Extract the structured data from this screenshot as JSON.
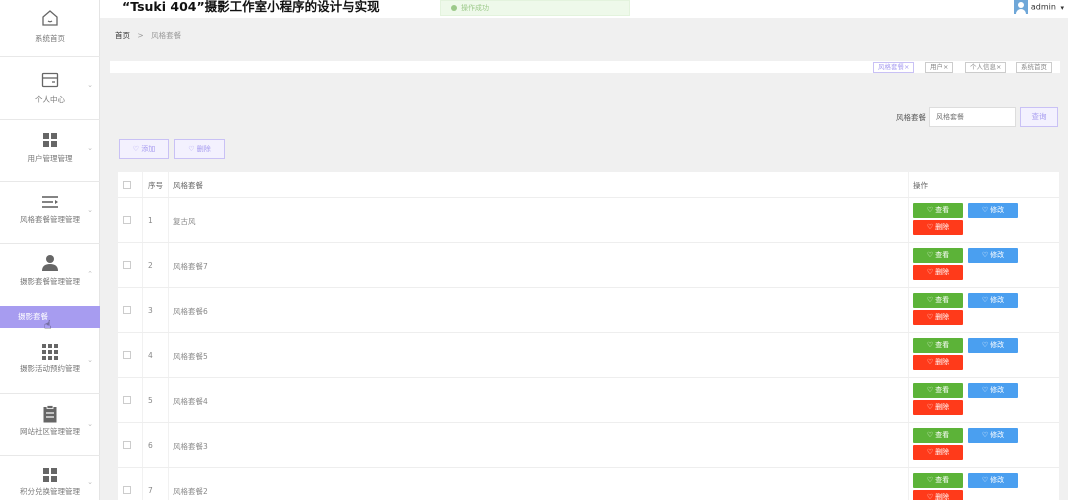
{
  "header": {
    "title": "“Tsuki 404”摄影工作室小程序的设计与实现",
    "toast": "操作成功",
    "user": "admin",
    "user_caret": "▾"
  },
  "sidebar": {
    "items": [
      {
        "label": "系统首页",
        "icon": "home-icon"
      },
      {
        "label": "个人中心",
        "icon": "wallet-icon"
      },
      {
        "label": "用户管理管理",
        "icon": "grid-icon"
      },
      {
        "label": "风格套餐管理管理",
        "icon": "list-icon"
      },
      {
        "label": "摄影套餐管理管理",
        "icon": "user-icon"
      },
      {
        "label": "摄影活动预约管理",
        "icon": "apps-icon"
      },
      {
        "label": "网站社区管理管理",
        "icon": "clipboard-icon"
      },
      {
        "label": "积分兑换管理管理",
        "icon": "grid-icon"
      }
    ],
    "active_sub": "摄影套餐",
    "chevron": "⌄",
    "chevron_up": "⌃"
  },
  "breadcrumb": {
    "home": "首页",
    "sep": ">",
    "current": "风格套餐"
  },
  "tags": [
    {
      "label": "风格套餐",
      "active": true
    },
    {
      "label": "用户",
      "active": false
    },
    {
      "label": "个人信息",
      "active": false
    },
    {
      "label": "系统首页",
      "active": false
    }
  ],
  "tag_close": "×",
  "search": {
    "label": "风格套餐",
    "placeholder": "风格套餐",
    "button": "查询"
  },
  "actions": {
    "add": "添加",
    "delete": "删除",
    "heart": "♡"
  },
  "table": {
    "headers": {
      "index": "序号",
      "name": "风格套餐",
      "ops": "操作"
    },
    "rows": [
      {
        "index": "1",
        "name": "复古风"
      },
      {
        "index": "2",
        "name": "风格套餐7"
      },
      {
        "index": "3",
        "name": "风格套餐6"
      },
      {
        "index": "4",
        "name": "风格套餐5"
      },
      {
        "index": "5",
        "name": "风格套餐4"
      },
      {
        "index": "6",
        "name": "风格套餐3"
      },
      {
        "index": "7",
        "name": "风格套餐2"
      }
    ],
    "row_buttons": {
      "view": "查看",
      "edit": "修改",
      "delete": "删除"
    }
  },
  "colors": {
    "accent": "#a79cf0",
    "view": "#5cb338",
    "edit": "#4a9ff0",
    "delete": "#ff3a1a"
  }
}
